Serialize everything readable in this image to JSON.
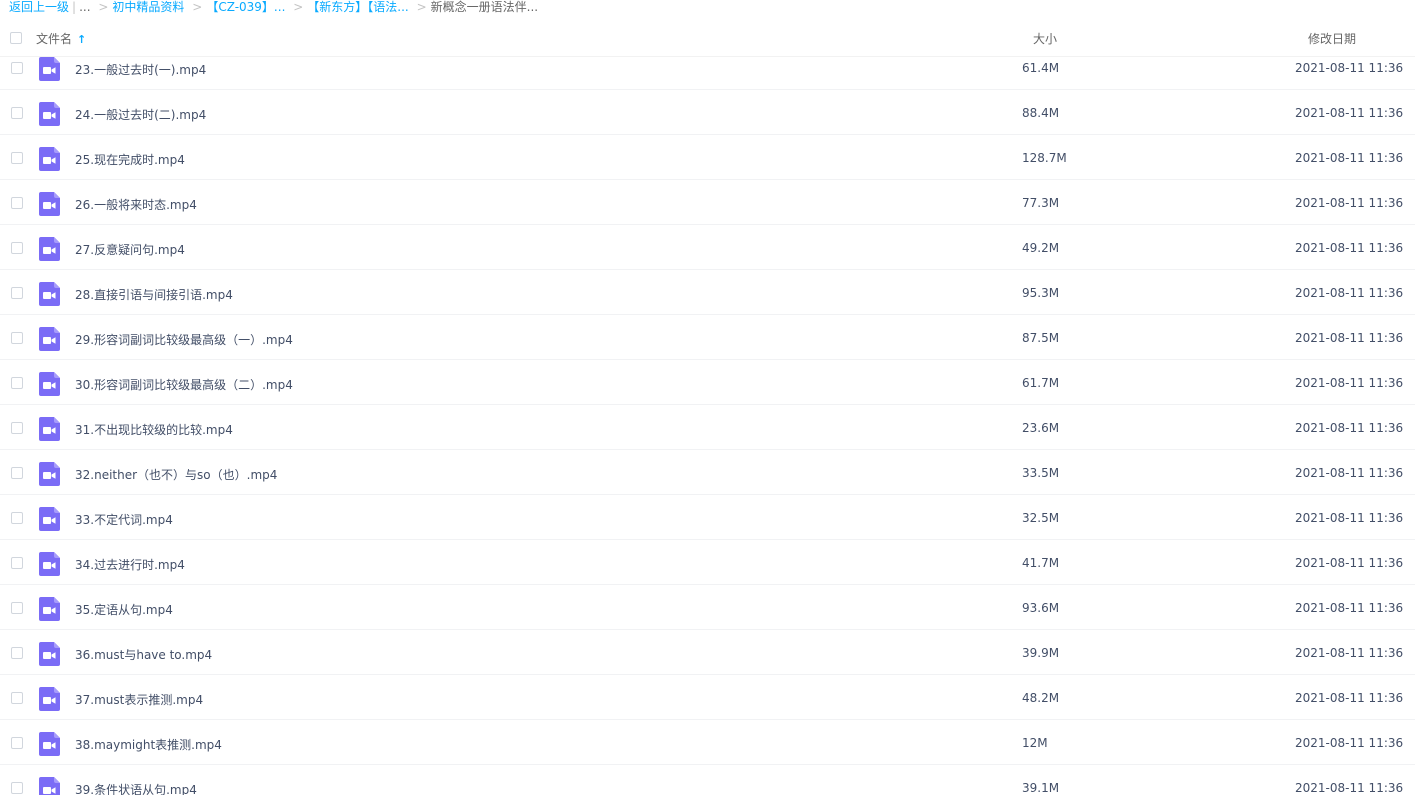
{
  "breadcrumb": {
    "back_label": "返回上一级",
    "bar": "|",
    "ellipsis": "...",
    "sep": ">",
    "items": [
      "初中精品资料",
      "【CZ-039】...",
      "【新东方】【语法...",
      "新概念一册语法伴..."
    ]
  },
  "header": {
    "name_label": "文件名",
    "size_label": "大小",
    "date_label": "修改日期",
    "sort_arrow": "↑"
  },
  "colors": {
    "accent": "#09aaff",
    "video_icon": "#7b6cf6"
  },
  "files": [
    {
      "name": "23.一般过去时(一).mp4",
      "size": "61.4M",
      "date": "2021-08-11 11:36",
      "icon": "video-file-icon"
    },
    {
      "name": "24.一般过去时(二).mp4",
      "size": "88.4M",
      "date": "2021-08-11 11:36",
      "icon": "video-file-icon"
    },
    {
      "name": "25.现在完成时.mp4",
      "size": "128.7M",
      "date": "2021-08-11 11:36",
      "icon": "video-file-icon"
    },
    {
      "name": "26.一般将来时态.mp4",
      "size": "77.3M",
      "date": "2021-08-11 11:36",
      "icon": "video-file-icon"
    },
    {
      "name": "27.反意疑问句.mp4",
      "size": "49.2M",
      "date": "2021-08-11 11:36",
      "icon": "video-file-icon"
    },
    {
      "name": "28.直接引语与间接引语.mp4",
      "size": "95.3M",
      "date": "2021-08-11 11:36",
      "icon": "video-file-icon"
    },
    {
      "name": "29.形容词副词比较级最高级（一）.mp4",
      "size": "87.5M",
      "date": "2021-08-11 11:36",
      "icon": "video-file-icon"
    },
    {
      "name": "30.形容词副词比较级最高级（二）.mp4",
      "size": "61.7M",
      "date": "2021-08-11 11:36",
      "icon": "video-file-icon"
    },
    {
      "name": "31.不出现比较级的比较.mp4",
      "size": "23.6M",
      "date": "2021-08-11 11:36",
      "icon": "video-file-icon"
    },
    {
      "name": "32.neither（也不）与so（也）.mp4",
      "size": "33.5M",
      "date": "2021-08-11 11:36",
      "icon": "video-file-icon"
    },
    {
      "name": "33.不定代词.mp4",
      "size": "32.5M",
      "date": "2021-08-11 11:36",
      "icon": "video-file-icon"
    },
    {
      "name": "34.过去进行时.mp4",
      "size": "41.7M",
      "date": "2021-08-11 11:36",
      "icon": "video-file-icon"
    },
    {
      "name": "35.定语从句.mp4",
      "size": "93.6M",
      "date": "2021-08-11 11:36",
      "icon": "video-file-icon"
    },
    {
      "name": "36.must与have to.mp4",
      "size": "39.9M",
      "date": "2021-08-11 11:36",
      "icon": "video-file-icon"
    },
    {
      "name": "37.must表示推测.mp4",
      "size": "48.2M",
      "date": "2021-08-11 11:36",
      "icon": "video-file-icon"
    },
    {
      "name": "38.maymight表推测.mp4",
      "size": "12M",
      "date": "2021-08-11 11:36",
      "icon": "video-file-icon"
    },
    {
      "name": "39.条件状语从句.mp4",
      "size": "39.1M",
      "date": "2021-08-11 11:36",
      "icon": "video-file-icon"
    }
  ]
}
